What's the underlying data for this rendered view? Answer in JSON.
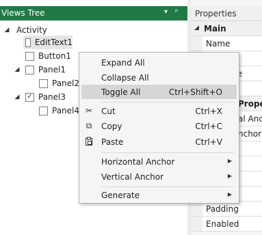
{
  "views_tree": {
    "title": "Views Tree",
    "header_icons": [
      "dropdown-arrow-icon",
      "pin-icon"
    ],
    "header_dropdown_glyph": "▾",
    "header_pin_glyph": "ᵖ",
    "items": [
      {
        "label": "Activity",
        "level": 0,
        "expander": "◢",
        "checkbox": false,
        "checked": false
      },
      {
        "label": "EditText1",
        "level": 1,
        "expander": "",
        "checkbox": true,
        "checked": false,
        "selected": true
      },
      {
        "label": "Button1",
        "level": 1,
        "expander": "",
        "checkbox": true,
        "checked": false
      },
      {
        "label": "Panel1",
        "level": 1,
        "expander": "◢",
        "checkbox": true,
        "checked": false
      },
      {
        "label": "Panel2",
        "level": 2,
        "expander": "",
        "checkbox": true,
        "checked": false
      },
      {
        "label": "Panel3",
        "level": 1,
        "expander": "◢",
        "checkbox": true,
        "checked": true
      },
      {
        "label": "Panel4",
        "level": 2,
        "expander": "",
        "checkbox": true,
        "checked": false
      }
    ],
    "check_glyph": "✓"
  },
  "properties": {
    "title": "Properties",
    "rows": [
      {
        "text": "Main",
        "category": true,
        "expander": "◢"
      },
      {
        "text": "Name",
        "category": false
      },
      {
        "text": "",
        "category": false
      },
      {
        "text": "me",
        "category": false
      },
      {
        "text": "",
        "category": false
      },
      {
        "text": "Prope",
        "category": true,
        "expander": ""
      },
      {
        "text": "al Anch",
        "category": false
      },
      {
        "text": "nchor",
        "category": false
      },
      {
        "text": "",
        "category": false
      },
      {
        "text": "",
        "category": false
      },
      {
        "text": "",
        "category": false
      },
      {
        "text": "",
        "category": false
      },
      {
        "text": "",
        "category": false
      },
      {
        "text": "",
        "category": false
      },
      {
        "text": "Padding",
        "category": false
      },
      {
        "text": "Enabled",
        "category": false
      }
    ]
  },
  "context_menu": {
    "items": [
      {
        "label": "Expand All",
        "shortcut": "",
        "icon": "",
        "submenu": false
      },
      {
        "label": "Collapse All",
        "shortcut": "",
        "icon": "",
        "submenu": false
      },
      {
        "label": "Toggle All",
        "shortcut": "Ctrl+Shift+O",
        "icon": "",
        "submenu": false,
        "highlighted": true
      },
      {
        "separator": true
      },
      {
        "label": "Cut",
        "shortcut": "Ctrl+X",
        "icon": "scissors-icon",
        "glyph": "✂",
        "submenu": false
      },
      {
        "label": "Copy",
        "shortcut": "Ctrl+C",
        "icon": "copy-icon",
        "glyph": "⧉",
        "submenu": false
      },
      {
        "label": "Paste",
        "shortcut": "Ctrl+V",
        "icon": "paste-icon",
        "glyph": "📋",
        "submenu": false
      },
      {
        "separator": true
      },
      {
        "label": "Horizontal Anchor",
        "shortcut": "",
        "icon": "",
        "submenu": true
      },
      {
        "label": "Vertical Anchor",
        "shortcut": "",
        "icon": "",
        "submenu": true
      },
      {
        "separator": true
      },
      {
        "label": "Generate",
        "shortcut": "",
        "icon": "",
        "submenu": true
      }
    ],
    "submenu_glyph": "▶"
  },
  "colors": {
    "views_header_bg": "#1f7a45",
    "menu_highlight": "#d6d6d6",
    "menu_bg": "#f5f5f5"
  }
}
